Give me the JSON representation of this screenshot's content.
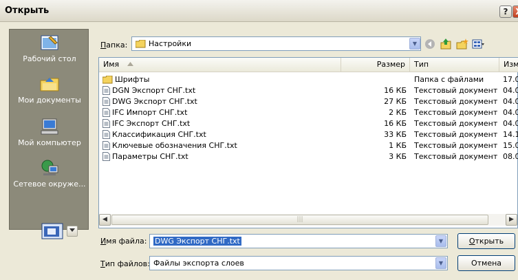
{
  "window": {
    "title": "Открыть",
    "help_label": "?",
    "close_label": "X"
  },
  "places": [
    {
      "label": "Рабочий стол",
      "icon": "desktop-icon"
    },
    {
      "label": "Мои документы",
      "icon": "my-documents-icon"
    },
    {
      "label": "Мой компьютер",
      "icon": "my-computer-icon"
    },
    {
      "label": "Сетевое окруже...",
      "icon": "network-icon"
    }
  ],
  "lookin": {
    "label_u": "П",
    "label_rest": "апка:",
    "value": "Настройки"
  },
  "columns": {
    "name": "Имя",
    "size": "Размер",
    "type": "Тип",
    "date": "Изм"
  },
  "files": [
    {
      "name": "Шрифты",
      "size": "",
      "type": "Папка с файлами",
      "date": "17.0",
      "icon": "folder-icon"
    },
    {
      "name": "DGN Экспорт СНГ.txt",
      "size": "16 КБ",
      "type": "Текстовый документ",
      "date": "04.0",
      "icon": "text-file-icon"
    },
    {
      "name": "DWG Экспорт СНГ.txt",
      "size": "27 КБ",
      "type": "Текстовый документ",
      "date": "04.0",
      "icon": "text-file-icon"
    },
    {
      "name": "IFC Импорт СНГ.txt",
      "size": "2 КБ",
      "type": "Текстовый документ",
      "date": "04.0",
      "icon": "text-file-icon"
    },
    {
      "name": "IFC Экспорт СНГ.txt",
      "size": "16 КБ",
      "type": "Текстовый документ",
      "date": "04.0",
      "icon": "text-file-icon"
    },
    {
      "name": "Классификация СНГ.txt",
      "size": "33 КБ",
      "type": "Текстовый документ",
      "date": "14.1",
      "icon": "text-file-icon"
    },
    {
      "name": "Ключевые обозначения СНГ.txt",
      "size": "1 КБ",
      "type": "Текстовый документ",
      "date": "15.0",
      "icon": "text-file-icon"
    },
    {
      "name": "Параметры СНГ.txt",
      "size": "3 КБ",
      "type": "Текстовый документ",
      "date": "08.0",
      "icon": "text-file-icon"
    }
  ],
  "filename": {
    "label_u": "И",
    "label_rest": "мя файла:",
    "value": "DWG Экспорт СНГ.txt"
  },
  "filetype": {
    "label_u": "Т",
    "label_rest": "ип файлов:",
    "value": "Файлы экспорта слоев"
  },
  "buttons": {
    "open_u": "О",
    "open_rest": "ткрыть",
    "cancel": "Отмена"
  },
  "colors": {
    "selection": "#316ac5",
    "places_bg": "#8c8a7a",
    "dialog_bg": "#ece9d8"
  }
}
